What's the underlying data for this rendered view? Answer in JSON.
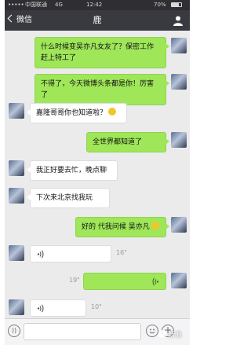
{
  "status_bar": {
    "carrier": "中国联通",
    "network": "4G",
    "time": "12:42",
    "battery": "70%"
  },
  "nav": {
    "back_label": "微信",
    "title": "鹿",
    "user_icon": "person-icon"
  },
  "messages": [
    {
      "side": "right",
      "text": "什么时候变吴亦凡女友了？保密工作赶上特工了"
    },
    {
      "side": "right",
      "text": "不得了，今天微博头条都是你！厉害了"
    },
    {
      "side": "left",
      "text": "嘉隆哥哥你也知道啦？",
      "emoji": "smile-emoji"
    },
    {
      "side": "right",
      "text": "全世界都知道了"
    },
    {
      "side": "left",
      "text": "我正好要去忙，晚点聊"
    },
    {
      "side": "left",
      "text": "下次来北京找我玩"
    },
    {
      "side": "right",
      "text": "好的  代我问候 吴亦凡",
      "emoji": "grin-emoji"
    }
  ],
  "voice_messages": [
    {
      "side": "left",
      "duration": "16\""
    },
    {
      "side": "right",
      "duration": "19\""
    },
    {
      "side": "left",
      "duration": "10\""
    }
  ],
  "watermark": "新浪",
  "colors": {
    "nav_bg": "#393a3f",
    "chat_bg": "#ebebeb",
    "sent_bubble": "#9fe659",
    "received_bubble": "#ffffff"
  }
}
